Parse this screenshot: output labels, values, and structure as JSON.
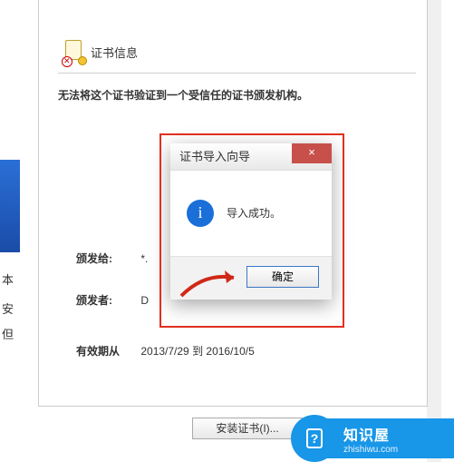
{
  "left_sidebar": {
    "t1": "本",
    "t2": "安",
    "t3": "但"
  },
  "cert": {
    "title": "证书信息",
    "warning": "无法将这个证书验证到一个受信任的证书颁发机构。",
    "issued_to": {
      "label": "颁发给:",
      "value": "*."
    },
    "issued_by": {
      "label": "颁发者:",
      "value": "D"
    },
    "valid": {
      "label": "有效期从",
      "value": "2013/7/29 到 2016/10/5"
    },
    "install_button": "安装证书(I)..."
  },
  "dialog": {
    "title": "证书导入向导",
    "message": "导入成功。",
    "ok": "确定",
    "close": "×"
  },
  "watermark": {
    "brand": "知识屋",
    "url": "zhishiwu.com"
  }
}
